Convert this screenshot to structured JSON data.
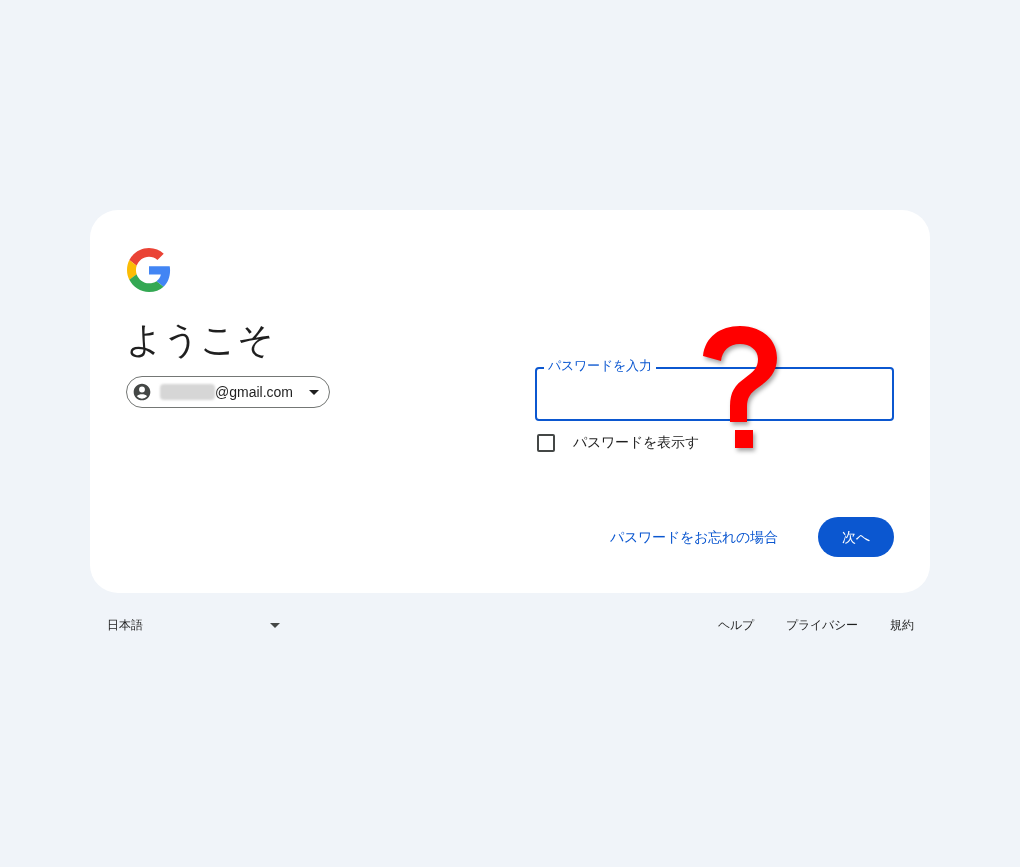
{
  "heading": "ようこそ",
  "account": {
    "email": "@gmail.com"
  },
  "password_field": {
    "label": "パスワードを入力",
    "focused": true
  },
  "show_password": {
    "label": "パスワードを表示す",
    "checked": false
  },
  "forgot_link": "パスワードをお忘れの場合",
  "next_button": "次へ",
  "footer": {
    "language": "日本語",
    "links": [
      "ヘルプ",
      "プライバシー",
      "規約"
    ]
  }
}
